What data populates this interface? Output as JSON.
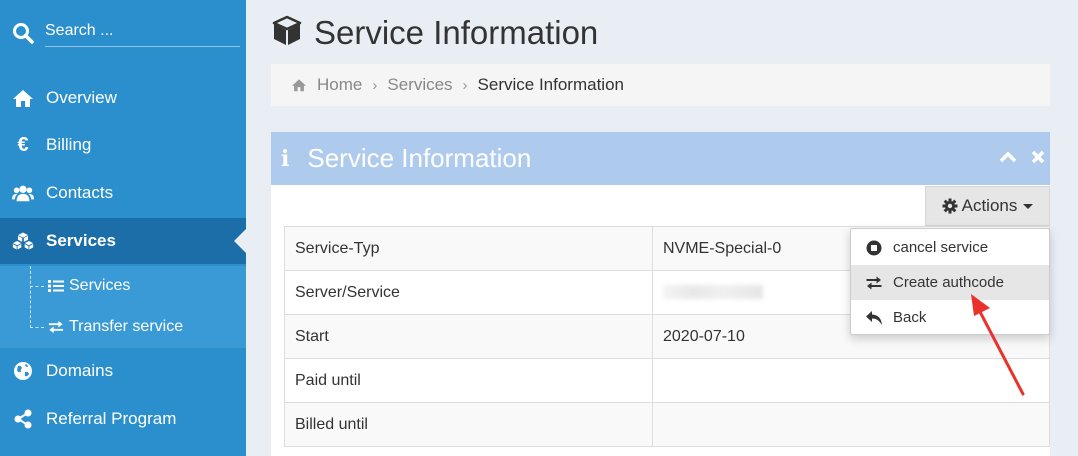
{
  "sidebar": {
    "search_label": "Search ...",
    "items": [
      {
        "label": "Overview",
        "icon": "home-icon"
      },
      {
        "label": "Billing",
        "icon": "euro-icon"
      },
      {
        "label": "Contacts",
        "icon": "users-icon"
      },
      {
        "label": "Services",
        "icon": "cubes-icon",
        "active": true
      },
      {
        "label": "Domains",
        "icon": "globe-icon"
      },
      {
        "label": "Referral Program",
        "icon": "share-icon"
      }
    ],
    "subitems": [
      {
        "label": "Services",
        "icon": "list-icon"
      },
      {
        "label": "Transfer service",
        "icon": "exchange-icon"
      }
    ]
  },
  "header": {
    "title": "Service Information"
  },
  "breadcrumb": {
    "home": "Home",
    "services": "Services",
    "current": "Service Information"
  },
  "panel": {
    "title": "Service Information",
    "actions_label": "Actions",
    "rows": [
      {
        "key": "Service-Typ",
        "value": "NVME-Special-0"
      },
      {
        "key": "Server/Service",
        "value": ""
      },
      {
        "key": "Start",
        "value": "2020-07-10"
      },
      {
        "key": "Paid until",
        "value": ""
      },
      {
        "key": "Billed until",
        "value": ""
      }
    ]
  },
  "dropdown": {
    "items": [
      {
        "label": "cancel service",
        "icon": "stop-circle-icon"
      },
      {
        "label": "Create authcode",
        "icon": "exchange-icon",
        "highlighted": true
      },
      {
        "label": "Back",
        "icon": "reply-icon"
      }
    ]
  },
  "colors": {
    "sidebar": "#2c8fcd",
    "sidebar_active": "#1c6ea8",
    "panel_header": "#aecbed",
    "annotation_arrow": "#e8322b"
  }
}
